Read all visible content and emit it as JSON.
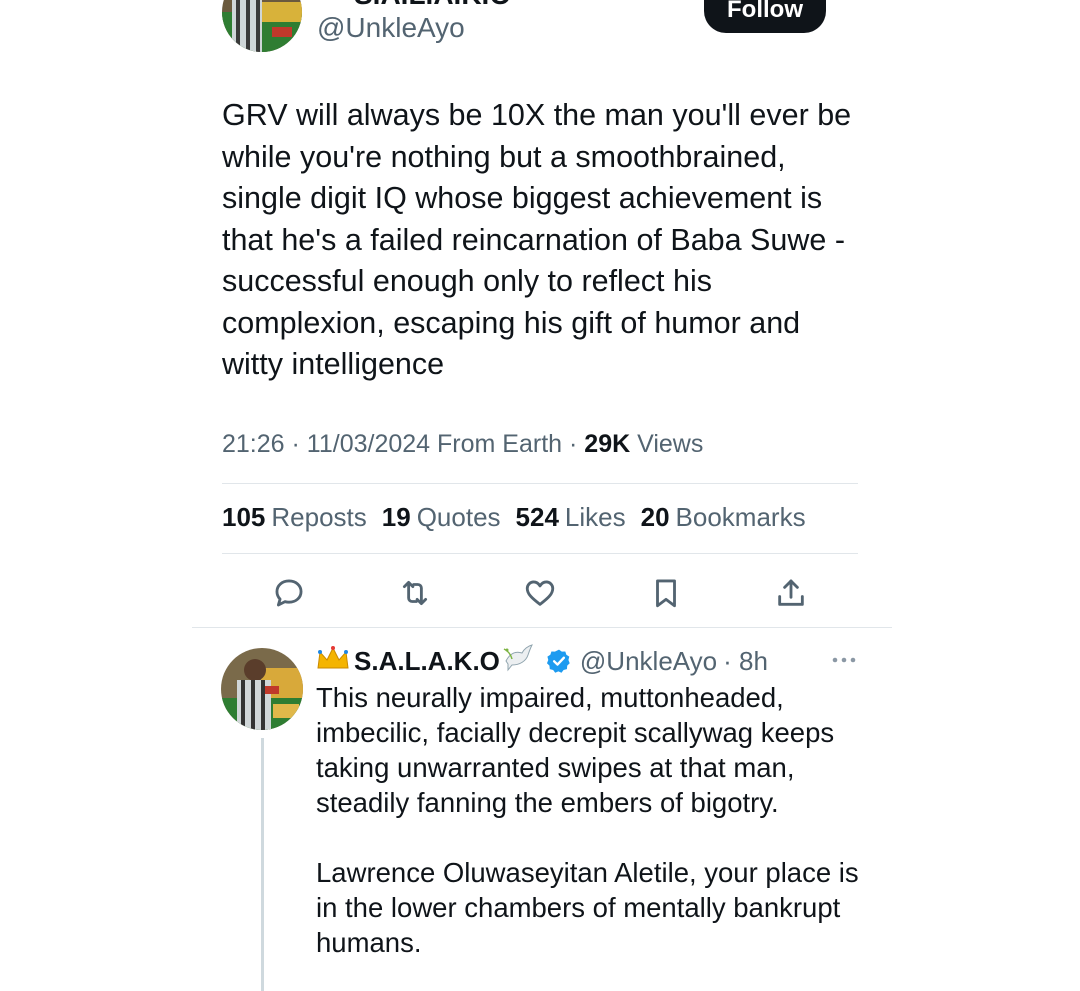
{
  "top": {
    "name": "S.A.L.A.K.O",
    "handle": "@UnkleAyo",
    "follow_label": "Follow"
  },
  "tweet": {
    "text": "GRV will always be 10X the man you'll ever be\nwhile you're nothing but a smoothbrained,\nsingle digit IQ whose biggest achievement is\nthat he's a failed reincarnation of Baba Suwe -\nsuccessful enough only to reflect his\ncomplexion, escaping his gift of humor and\nwitty intelligence",
    "time": "21:26",
    "date": "11/03/2024",
    "source": "From Earth",
    "views_count": "29K",
    "views_label": "Views",
    "separator": "·"
  },
  "stats": [
    {
      "count": "105",
      "label": "Reposts"
    },
    {
      "count": "19",
      "label": "Quotes"
    },
    {
      "count": "524",
      "label": "Likes"
    },
    {
      "count": "20",
      "label": "Bookmarks"
    }
  ],
  "actions": [
    "reply-icon",
    "repost-icon",
    "like-icon",
    "bookmark-icon",
    "share-icon"
  ],
  "reply": {
    "name": "S.A.L.A.K.O",
    "handle": "@UnkleAyo",
    "time": "· 8h",
    "text": "This neurally impaired, muttonheaded,\nimbecilic, facially decrepit scallywag keeps\ntaking unwarranted swipes at that man,\nsteadily fanning the embers of bigotry.\n\nLawrence Oluwaseyitan Aletile, your place is\nin the lower chambers of mentally bankrupt\nhumans."
  },
  "colors": {
    "text": "#0f1419",
    "secondary": "#536471",
    "verified": "#1d9bf0",
    "divider": "#e1e6ea",
    "thread_line": "#cfd9de",
    "crown": "#f4b400"
  }
}
